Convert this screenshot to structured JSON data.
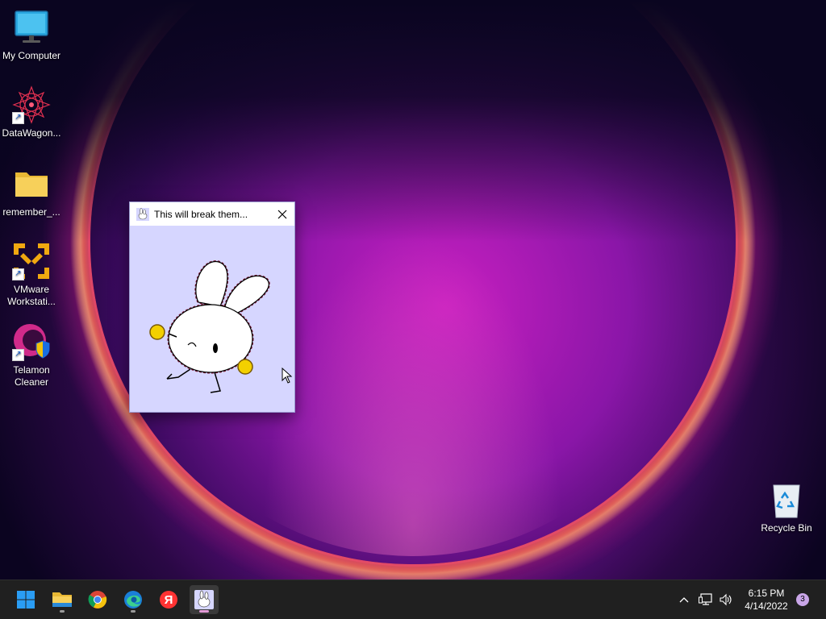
{
  "desktop": {
    "icons": [
      {
        "label": "My Computer",
        "icon": "monitor-icon"
      },
      {
        "label": "DataWagon...",
        "icon": "mandala-icon"
      },
      {
        "label": "remember_...",
        "icon": "folder-icon"
      },
      {
        "label": "VMware Workstati...",
        "icon": "vmware-icon"
      },
      {
        "label": "Telamon Cleaner",
        "icon": "telamon-icon"
      },
      {
        "label": "Recycle Bin",
        "icon": "recycle-bin-icon"
      }
    ]
  },
  "window": {
    "title": "This will break them...",
    "close_icon": "close-icon",
    "content": "bunny-image"
  },
  "taskbar": {
    "apps": [
      {
        "name": "Start",
        "icon": "windows-start-icon"
      },
      {
        "name": "File Explorer",
        "icon": "file-explorer-icon"
      },
      {
        "name": "Google Chrome",
        "icon": "chrome-icon"
      },
      {
        "name": "Microsoft Edge",
        "icon": "edge-icon"
      },
      {
        "name": "Yandex",
        "icon": "yandex-icon"
      },
      {
        "name": "This will break them...",
        "icon": "bunny-app-icon"
      }
    ],
    "tray": {
      "time": "6:15 PM",
      "date": "4/14/2022",
      "notifications": "3"
    }
  },
  "colors": {
    "taskbar": "#202020",
    "window_bg": "#d6d6ff",
    "accent_indicator": "#e39ad8"
  }
}
